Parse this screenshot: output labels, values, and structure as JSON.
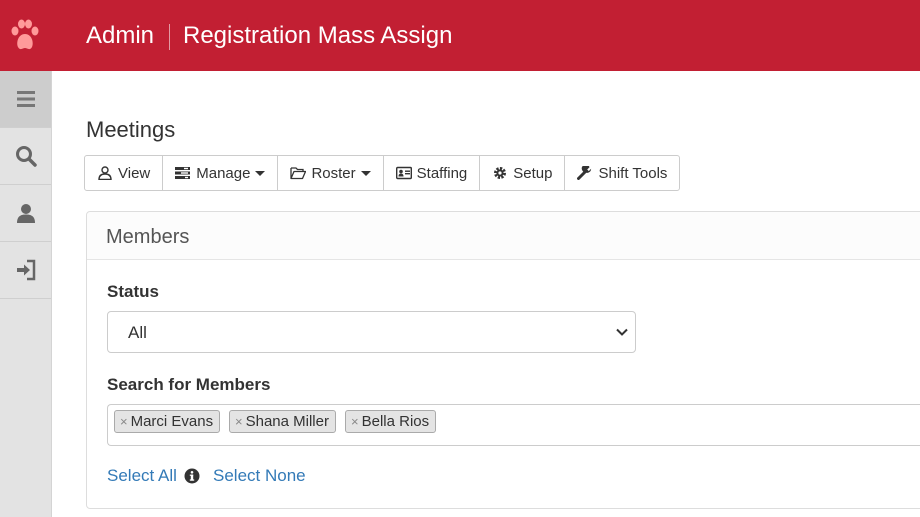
{
  "header": {
    "section": "Admin",
    "page": "Registration Mass Assign",
    "brand_icon": "paw-icon",
    "color": "#c21f33"
  },
  "sidebar": {
    "items": [
      {
        "icon": "menu-icon"
      },
      {
        "icon": "search-icon"
      },
      {
        "icon": "user-icon"
      },
      {
        "icon": "sign-in-icon"
      }
    ]
  },
  "main": {
    "title": "Meetings",
    "toolbar": [
      {
        "label": "View",
        "icon": "user-outline-icon",
        "dropdown": false
      },
      {
        "label": "Manage",
        "icon": "tasks-icon",
        "dropdown": true
      },
      {
        "label": "Roster",
        "icon": "folder-open-icon",
        "dropdown": true
      },
      {
        "label": "Staffing",
        "icon": "id-card-icon",
        "dropdown": false
      },
      {
        "label": "Setup",
        "icon": "cog-icon",
        "dropdown": false
      },
      {
        "label": "Shift Tools",
        "icon": "wrench-icon",
        "dropdown": false
      }
    ]
  },
  "members_panel": {
    "title": "Members",
    "status_label": "Status",
    "status_value": "All",
    "search_label": "Search for Members",
    "tags": [
      "Marci Evans",
      "Shana Miller",
      "Bella Rios"
    ],
    "select_all": "Select All",
    "select_none": "Select None",
    "link_color": "#337ab7"
  }
}
